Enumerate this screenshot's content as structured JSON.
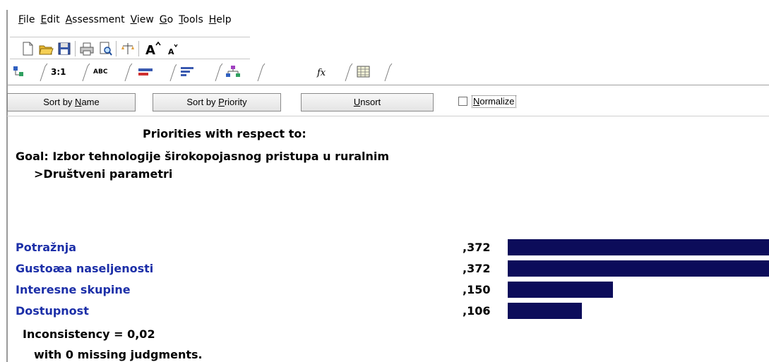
{
  "menu": {
    "items": [
      {
        "key": "F",
        "rest": "ile"
      },
      {
        "key": "E",
        "rest": "dit"
      },
      {
        "key": "A",
        "rest": "ssessment"
      },
      {
        "key": "V",
        "rest": "iew"
      },
      {
        "key": "G",
        "rest": "o"
      },
      {
        "key": "T",
        "rest": "ools"
      },
      {
        "key": "H",
        "rest": "elp"
      }
    ]
  },
  "tabs": {
    "ratio_label": "3:1",
    "abc_label": "ABC"
  },
  "buttons": {
    "sort_name_pre": "Sort by ",
    "sort_name_key": "N",
    "sort_name_post": "ame",
    "sort_priority_pre": "Sort by ",
    "sort_priority_key": "P",
    "sort_priority_post": "riority",
    "unsort_key": "U",
    "unsort_post": "nsort",
    "normalize_key": "N",
    "normalize_post": "ormalize",
    "normalize_checked": false
  },
  "content": {
    "heading": "Priorities with respect to:",
    "goal": "Goal: Izbor tehnologije širokopojasnog pristupa u ruralnim",
    "subnode": ">Društveni parametri"
  },
  "colors": {
    "bar": "#0c0c5a",
    "item_text": "#1c2fa8"
  },
  "items": [
    {
      "name": "Potražnja",
      "value": ",372",
      "priority": 0.372
    },
    {
      "name": "Gustoæa naseljenosti",
      "value": ",372",
      "priority": 0.372
    },
    {
      "name": "Interesne skupine",
      "value": ",150",
      "priority": 0.15
    },
    {
      "name": "Dostupnost",
      "value": ",106",
      "priority": 0.106
    }
  ],
  "footer": {
    "inconsistency": "Inconsistency = 0,02",
    "missing": "with 0  missing judgments."
  }
}
